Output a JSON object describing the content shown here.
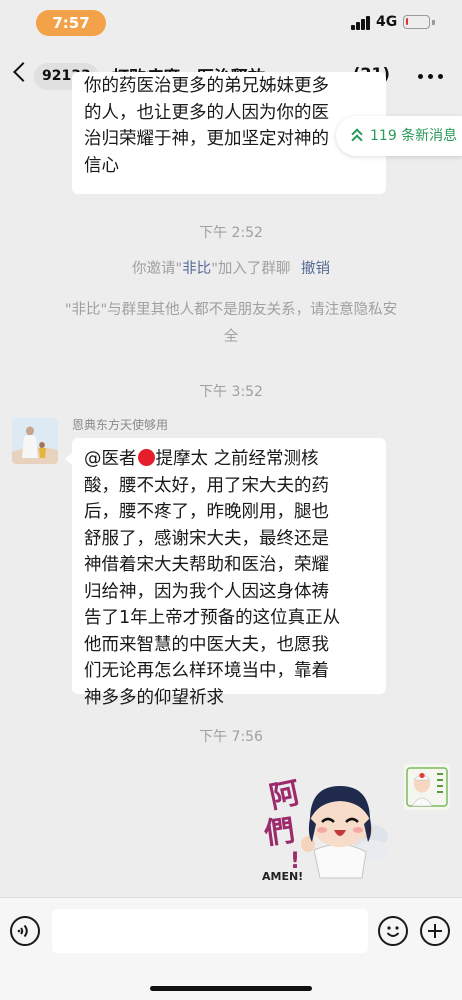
{
  "status_bar": {
    "time": "7:57",
    "network": "4G",
    "battery_level": 0.12,
    "icons": [
      "signal-icon",
      "battery-icon"
    ]
  },
  "nav": {
    "unread_count": "92133",
    "title": "打败病魔，医治释放，…",
    "member_count": "(21)",
    "icons": [
      "back-icon",
      "more-icon"
    ]
  },
  "top_message": {
    "lines": [
      "你的药医治更多的弟兄姊妹更多",
      "的人，也让更多的人因为你的医",
      "治归荣耀于神，更加坚定对神的",
      "信心"
    ]
  },
  "new_messages": {
    "label": "119 条新消息",
    "icon": "double-chevron-up-icon"
  },
  "timestamps": {
    "t1": "下午 2:52",
    "t2": "下午 3:52",
    "t3": "下午 7:56"
  },
  "system": {
    "invite_prefix": "你邀请\"",
    "invite_name": "非比",
    "invite_suffix": "\"加入了群聊",
    "revoke": "撤销",
    "privacy_line1": "\"非比\"与群里其他人都不是朋友关系，请注意隐私安",
    "privacy_line2": "全"
  },
  "message": {
    "sender": "恩典东方天使够用",
    "mention_prefix": "@医者",
    "mention_suffix": "提摩太 之前经常测核",
    "lines": [
      "酸，腰不太好，用了宋大夫的药",
      "后，腰不疼了，昨晚刚用，腿也",
      "舒服了，感谢宋大夫，最终还是",
      "神借着宋大夫帮助和医治，荣耀",
      "归给神，因为我个人因这身体祷",
      "告了1年上帝才预备的这位真正从",
      "他而来智慧的中医大夫，也愿我",
      "们无论再怎么样环境当中，靠着",
      "神多多的仰望祈求"
    ]
  },
  "sticker": {
    "big_text_1": "阿",
    "big_text_2": "們",
    "excl": "!",
    "caption": "AMEN!"
  },
  "input": {
    "placeholder": "",
    "icons": [
      "voice-icon",
      "emoji-icon",
      "plus-icon"
    ]
  }
}
